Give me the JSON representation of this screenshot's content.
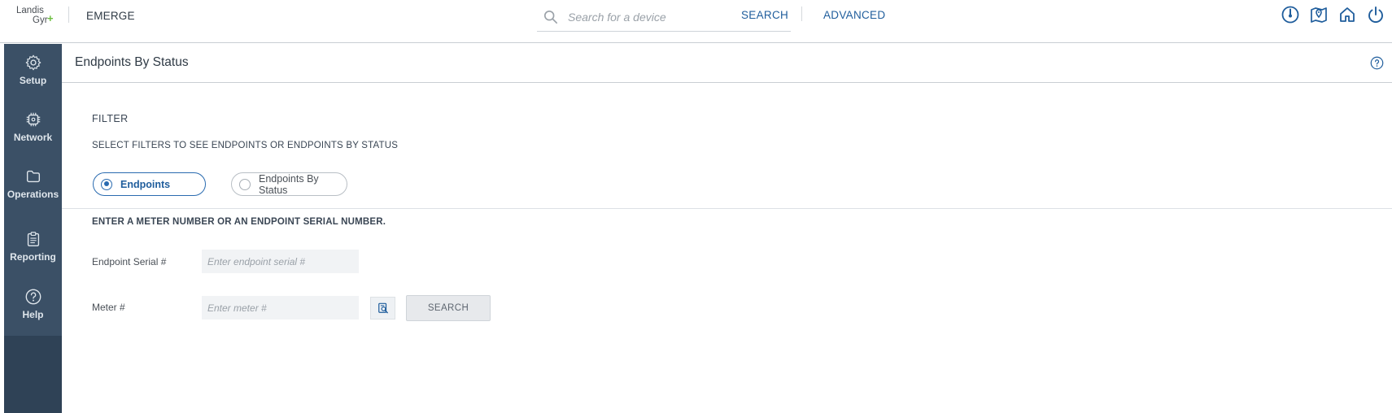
{
  "header": {
    "logo_line1": "Landis",
    "logo_line2": "Gyr",
    "logo_plus": "+",
    "app_name": "EMERGE",
    "search_placeholder": "Search for a device",
    "search_label": "SEARCH",
    "advanced_label": "ADVANCED",
    "icons": [
      "dashboard-gauge-icon",
      "map-pin-icon",
      "home-icon",
      "power-icon"
    ],
    "accent_color": "#1f5d9c"
  },
  "sidebar": {
    "items": [
      {
        "label": "Setup",
        "icon": "gear-icon"
      },
      {
        "label": "Network",
        "icon": "chip-icon"
      },
      {
        "label": "Operations",
        "icon": "folder-icon"
      },
      {
        "label": "Reporting",
        "icon": "clipboard-icon"
      },
      {
        "label": "Help",
        "icon": "help-icon"
      }
    ],
    "background": "#3b5066"
  },
  "page": {
    "title": "Endpoints By Status",
    "filter_heading": "FILTER",
    "filter_instruction": "SELECT FILTERS TO SEE ENDPOINTS OR ENDPOINTS BY STATUS",
    "radio_options": [
      {
        "label": "Endpoints",
        "selected": true
      },
      {
        "label": "Endpoints By Status",
        "selected": false
      }
    ],
    "meter_instruction": "ENTER A METER NUMBER OR AN ENDPOINT SERIAL NUMBER.",
    "fields": {
      "endpoint_serial": {
        "label": "Endpoint Serial #",
        "placeholder": "Enter endpoint serial #",
        "value": ""
      },
      "meter": {
        "label": "Meter #",
        "placeholder": "Enter meter #",
        "value": ""
      }
    },
    "search_button": "SEARCH"
  }
}
